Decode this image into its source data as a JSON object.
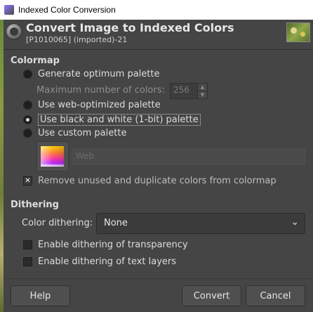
{
  "window": {
    "title": "Indexed Color Conversion"
  },
  "header": {
    "title": "Convert Image to Indexed Colors",
    "subtitle": "[P1010065] (imported)-21"
  },
  "colormap": {
    "section_title": "Colormap",
    "options": {
      "optimum": "Generate optimum palette",
      "max_colors_label": "Maximum number of colors:",
      "max_colors_value": "256",
      "web": "Use web-optimized palette",
      "bw": "Use black and white (1-bit) palette",
      "custom": "Use custom palette"
    },
    "selected": "bw",
    "custom_palette_name": "Web",
    "remove_unused_label": "Remove unused and duplicate colors from colormap",
    "remove_unused_checked": true
  },
  "dithering": {
    "section_title": "Dithering",
    "color_dithering_label": "Color dithering:",
    "color_dithering_value": "None",
    "transparency_label": "Enable dithering of transparency",
    "transparency_checked": false,
    "text_layers_label": "Enable dithering of text layers",
    "text_layers_checked": false
  },
  "buttons": {
    "help": "Help",
    "convert": "Convert",
    "cancel": "Cancel"
  },
  "icons": {
    "app": "gimp-icon",
    "header": "convert-indexed-icon",
    "dropdown": "chevron-down-icon",
    "check": "checkmark-icon"
  }
}
